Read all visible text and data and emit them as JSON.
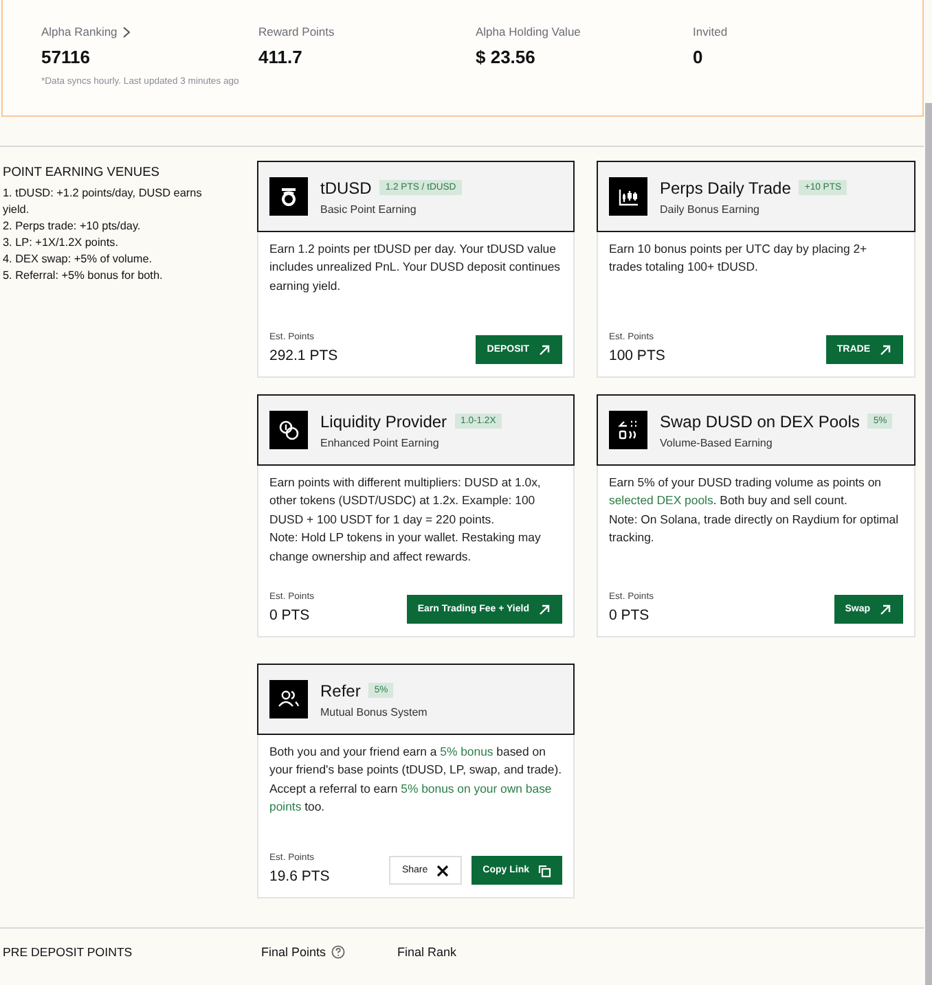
{
  "stats": [
    {
      "label": "Alpha Ranking",
      "has_link": true,
      "value": "57116"
    },
    {
      "label": "Reward Points",
      "has_link": false,
      "value": "411.7"
    },
    {
      "label": "Alpha Holding Value",
      "has_link": false,
      "value": "$ 23.56"
    },
    {
      "label": "Invited",
      "has_link": false,
      "value": "0"
    }
  ],
  "sync_note": "*Data syncs hourly. Last updated 3 minutes ago",
  "venues": {
    "heading": "POINT EARNING VENUES",
    "items": [
      "1. tDUSD: +1.2 points/day, DUSD earns yield.",
      "2. Perps trade: +10 pts/day.",
      "3. LP: +1X/1.2X points.",
      "4. DEX swap: +5% of volume.",
      "5. Referral: +5% bonus for both."
    ]
  },
  "cards": [
    {
      "kind": "deposit",
      "title": "tDUSD",
      "badge": "1.2 PTS / tDUSD",
      "subtitle": "Basic Point Earning",
      "paragraphs": [
        [
          {
            "text": "Earn 1.2 points per tDUSD per day. Your tDUSD value includes unrealized PnL. Your DUSD deposit continues earning yield.",
            "highlight": false
          }
        ]
      ],
      "est_label": "Est. Points",
      "est_value": "292.1 PTS",
      "buttons": [
        {
          "kind": "external",
          "label": "DEPOSIT"
        }
      ]
    },
    {
      "kind": "trade",
      "title": "Perps Daily Trade",
      "badge": "+10 PTS",
      "subtitle": "Daily Bonus Earning",
      "paragraphs": [
        [
          {
            "text": "Earn 10 bonus points per UTC day by placing 2+ trades totaling 100+ tDUSD.",
            "highlight": false
          }
        ]
      ],
      "est_label": "Est. Points",
      "est_value": "100 PTS",
      "buttons": [
        {
          "kind": "external",
          "label": "TRADE"
        }
      ]
    },
    {
      "kind": "liquidity",
      "title": "Liquidity Provider",
      "badge": "1.0-1.2X",
      "subtitle": "Enhanced Point Earning",
      "paragraphs": [
        [
          {
            "text": "Earn points with different multipliers: DUSD at 1.0x, other tokens (USDT/USDC) at 1.2x. Example: 100 DUSD + 100 USDT for 1 day = 220 points.",
            "highlight": false
          }
        ],
        [
          {
            "text": "Note: Hold LP tokens in your wallet. Restaking may change ownership and affect rewards.",
            "highlight": false
          }
        ]
      ],
      "est_label": "Est. Points",
      "est_value": "0 PTS",
      "buttons": [
        {
          "kind": "external",
          "label": "Earn Trading Fee + Yield"
        }
      ]
    },
    {
      "kind": "swap",
      "title": "Swap DUSD on DEX Pools",
      "badge": "5%",
      "subtitle": "Volume-Based Earning",
      "paragraphs": [
        [
          {
            "text": "Earn 5% of your DUSD trading volume as points on ",
            "highlight": false
          },
          {
            "text": "selected DEX pools",
            "highlight": true
          },
          {
            "text": ". Both buy and sell count.",
            "highlight": false
          }
        ],
        [
          {
            "text": "Note: On Solana, trade directly on Raydium for optimal tracking.",
            "highlight": false
          }
        ]
      ],
      "est_label": "Est. Points",
      "est_value": "0 PTS",
      "buttons": [
        {
          "kind": "external",
          "label": "Swap"
        }
      ]
    },
    {
      "kind": "refer",
      "title": "Refer",
      "badge": "5%",
      "subtitle": "Mutual Bonus System",
      "paragraphs": [
        [
          {
            "text": "Both you and your friend earn a ",
            "highlight": false
          },
          {
            "text": "5% bonus",
            "highlight": true
          },
          {
            "text": " based on your friend's base points (tDUSD, LP, swap, and trade).",
            "highlight": false
          }
        ],
        [
          {
            "text": "Accept a referral to earn ",
            "highlight": false
          },
          {
            "text": "5% bonus on your own base points",
            "highlight": true
          },
          {
            "text": " too.",
            "highlight": false
          }
        ]
      ],
      "est_label": "Est. Points",
      "est_value": "19.6 PTS",
      "buttons": [
        {
          "kind": "share",
          "label": "Share"
        },
        {
          "kind": "copy",
          "label": "Copy Link"
        }
      ]
    }
  ],
  "pre_deposit": {
    "heading": "PRE DEPOSIT POINTS",
    "columns": [
      {
        "label": "Final Points",
        "has_help": true
      },
      {
        "label": "Final Rank",
        "has_help": false
      }
    ]
  }
}
